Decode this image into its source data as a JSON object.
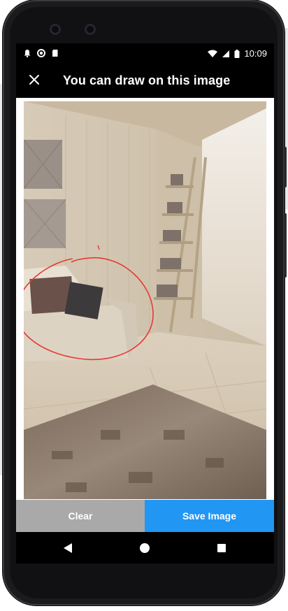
{
  "status_bar": {
    "time": "10:09",
    "left_icons": [
      "notification-bell-icon",
      "circle-status-icon",
      "sd-card-icon"
    ],
    "right_icons": [
      "wifi-icon",
      "cellular-signal-icon",
      "battery-icon"
    ]
  },
  "app_bar": {
    "title": "You can draw on this image",
    "close_icon": "close-icon"
  },
  "drawing": {
    "stroke_color": "#e53935",
    "annotation_mark": "1"
  },
  "buttons": {
    "clear_label": "Clear",
    "save_label": "Save Image",
    "clear_color": "#a9a9a9",
    "save_color": "#2196f3"
  },
  "nav_bar": {
    "back_icon": "back-triangle-icon",
    "home_icon": "home-circle-icon",
    "recents_icon": "recents-square-icon"
  }
}
